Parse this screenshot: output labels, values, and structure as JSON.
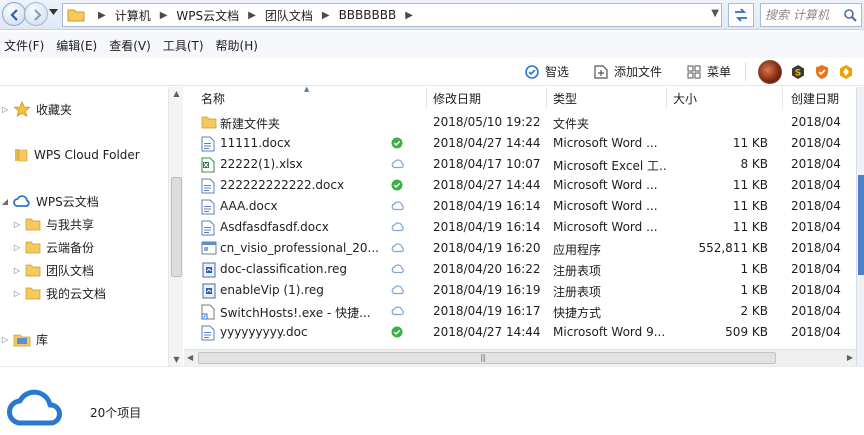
{
  "address_bar": {
    "breadcrumbs": [
      "计算机",
      "WPS云文档",
      "团队文档",
      "BBBBBBB"
    ],
    "search_placeholder": "搜索 计算机"
  },
  "menu": [
    "文件(F)",
    "编辑(E)",
    "查看(V)",
    "工具(T)",
    "帮助(H)"
  ],
  "toolbar": {
    "smart_label": "智选",
    "add_file_label": "添加文件",
    "menu_label": "菜单"
  },
  "nav_pane": {
    "favorites": "收藏夹",
    "wps_cloud_folder": "WPS Cloud Folder",
    "wps_cloud_docs": "WPS云文档",
    "children": [
      "与我共享",
      "云端备份",
      "团队文档",
      "我的云文档"
    ],
    "library": "库"
  },
  "file_list": {
    "columns": [
      "名称",
      "修改日期",
      "类型",
      "大小",
      "创建日期"
    ],
    "rows": [
      {
        "name": "新建文件夹",
        "icon": "folder-icon",
        "status": "",
        "modified": "2018/05/10 19:22",
        "type": "文件夹",
        "size": "",
        "created": "2018/04"
      },
      {
        "name": "11111.docx",
        "icon": "word-doc-icon",
        "status": "synced",
        "modified": "2018/04/27 14:44",
        "type": "Microsoft Word ...",
        "size": "11 KB",
        "created": "2018/04"
      },
      {
        "name": "22222(1).xlsx",
        "icon": "excel-icon",
        "status": "cloud",
        "modified": "2018/04/17 10:07",
        "type": "Microsoft Excel 工...",
        "size": "8 KB",
        "created": "2018/04"
      },
      {
        "name": "222222222222.docx",
        "icon": "word-doc-icon",
        "status": "synced",
        "modified": "2018/04/27 14:44",
        "type": "Microsoft Word ...",
        "size": "11 KB",
        "created": "2018/04"
      },
      {
        "name": "AAA.docx",
        "icon": "word-doc-icon",
        "status": "cloud",
        "modified": "2018/04/19 16:14",
        "type": "Microsoft Word ...",
        "size": "11 KB",
        "created": "2018/04"
      },
      {
        "name": "Asdfasdfasdf.docx",
        "icon": "word-doc-icon",
        "status": "cloud",
        "modified": "2018/04/19 16:14",
        "type": "Microsoft Word ...",
        "size": "11 KB",
        "created": "2018/04"
      },
      {
        "name": "cn_visio_professional_20...",
        "icon": "exe-icon",
        "status": "cloud",
        "modified": "2018/04/19 16:20",
        "type": "应用程序",
        "size": "552,811 KB",
        "created": "2018/04"
      },
      {
        "name": "doc-classification.reg",
        "icon": "reg-icon",
        "status": "cloud",
        "modified": "2018/04/20 16:22",
        "type": "注册表项",
        "size": "1 KB",
        "created": "2018/04"
      },
      {
        "name": "enableVip (1).reg",
        "icon": "reg-icon",
        "status": "cloud",
        "modified": "2018/04/19 16:19",
        "type": "注册表项",
        "size": "1 KB",
        "created": "2018/04"
      },
      {
        "name": "SwitchHosts!.exe - 快捷...",
        "icon": "shortcut-icon",
        "status": "cloud",
        "modified": "2018/04/19 16:17",
        "type": "快捷方式",
        "size": "2 KB",
        "created": "2018/04"
      },
      {
        "name": "yyyyyyyyy.doc",
        "icon": "word-doc-icon",
        "status": "synced",
        "modified": "2018/04/27 14:44",
        "type": "Microsoft Word 9...",
        "size": "509 KB",
        "created": "2018/04"
      }
    ]
  },
  "details_pane": {
    "item_count": "20个项目"
  },
  "colors": {
    "accent": "#2b78d0",
    "synced_green": "#3cb043",
    "cloud_outline": "#7ea6d6",
    "folder_yellow": "#f4c95d"
  }
}
